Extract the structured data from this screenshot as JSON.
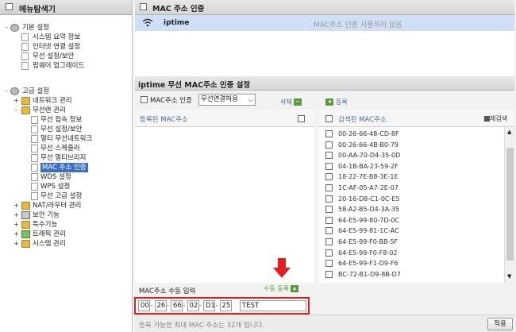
{
  "sidebar": {
    "title": "메뉴탐색기",
    "items": [
      {
        "label": "기본 설정",
        "level": 0,
        "expander": "-",
        "icon": "gear-icon"
      },
      {
        "label": "시스템 요약 정보",
        "level": 1,
        "icon": "page-icon"
      },
      {
        "label": "인터넷 연결 설정",
        "level": 1,
        "icon": "page-icon"
      },
      {
        "label": "무선 설정/보안",
        "level": 1,
        "icon": "page-icon"
      },
      {
        "label": "펌웨어 업그레이드",
        "level": 1,
        "icon": "page-icon"
      },
      {
        "label": "고급 설정",
        "level": 0,
        "expander": "-",
        "icon": "gear-icon"
      },
      {
        "label": "네트워크 관리",
        "level": 1,
        "expander": "+",
        "icon": "folder-icon"
      },
      {
        "label": "무선랜 관리",
        "level": 1,
        "expander": "-",
        "icon": "folder-icon"
      },
      {
        "label": "무선 접속 정보",
        "level": 2,
        "icon": "page-icon"
      },
      {
        "label": "무선 설정/보안",
        "level": 2,
        "icon": "page-icon"
      },
      {
        "label": "멀티 무선네트워크",
        "level": 2,
        "icon": "page-icon"
      },
      {
        "label": "무선 스케줄러",
        "level": 2,
        "icon": "page-icon"
      },
      {
        "label": "무선 멀티브리지",
        "level": 2,
        "icon": "page-icon"
      },
      {
        "label": "MAC 주소 인증",
        "level": 2,
        "icon": "page-icon",
        "selected": true
      },
      {
        "label": "WDS 설정",
        "level": 2,
        "icon": "page-icon"
      },
      {
        "label": "WPS 설정",
        "level": 2,
        "icon": "page-icon"
      },
      {
        "label": "무선 고급 설정",
        "level": 2,
        "icon": "page-icon"
      },
      {
        "label": "NAT/라우터 관리",
        "level": 1,
        "expander": "+",
        "icon": "folder-icon"
      },
      {
        "label": "보안 기능",
        "level": 1,
        "expander": "+",
        "icon": "shield-icon"
      },
      {
        "label": "특수기능",
        "level": 1,
        "expander": "+",
        "icon": "folder-icon"
      },
      {
        "label": "트래픽 관리",
        "level": 1,
        "expander": "+",
        "icon": "chart-icon"
      },
      {
        "label": "시스템 관리",
        "level": 1,
        "expander": "+",
        "icon": "folder-icon"
      }
    ]
  },
  "main": {
    "section_title": "MAC 주소 인증",
    "ap": {
      "name": "iptime",
      "status": "MAC주소 인증 사용하지 않음"
    },
    "settings_title": "iptime  무선 MAC주소 인증 설정",
    "auth_checkbox_label": "MAC주소 인증",
    "auth_select_value": "무선연결허용",
    "delete_label": "삭제",
    "register_label": "등록",
    "registered_header": "등록된 MAC주소",
    "searched_header": "검색된 MAC주소",
    "rescan_label": "재검색",
    "searched_macs": [
      "00-26-66-48-CD-8F",
      "00-26-66-4B-B0-79",
      "00-AA-70-D4-35-0D",
      "04-1B-BA-23-59-2F",
      "18-22-7E-B8-3E-1E",
      "1C-AF-05-A7-2E-07",
      "20-16-D8-C1-0C-E5",
      "58-A2-B5-D4-3A-35",
      "64-E5-99-80-7D-0C",
      "64-E5-99-81-1C-AC",
      "64-E5-99-F0-BB-5F",
      "64-E5-99-F0-F8-02",
      "64-E5-99-F1-D9-F6",
      "BC-72-B1-D9-8B-D7"
    ],
    "manual_input_label": "MAC주소 수동 입력",
    "manual_register_label": "수동 등록",
    "manual_mac": [
      "00",
      "26",
      "66",
      "02",
      "D1",
      "25"
    ],
    "manual_name": "TEST",
    "max_note": "등록 가능한 최대 MAC 주소는 32개 입니다.",
    "apply_label": "적용"
  },
  "colors": {
    "selected_row": "#cfe0f6",
    "selected_item": "#3b6fc9",
    "highlight_box": "#e02020",
    "arrow": "#e02020",
    "header_text": "#4a6b9a"
  }
}
